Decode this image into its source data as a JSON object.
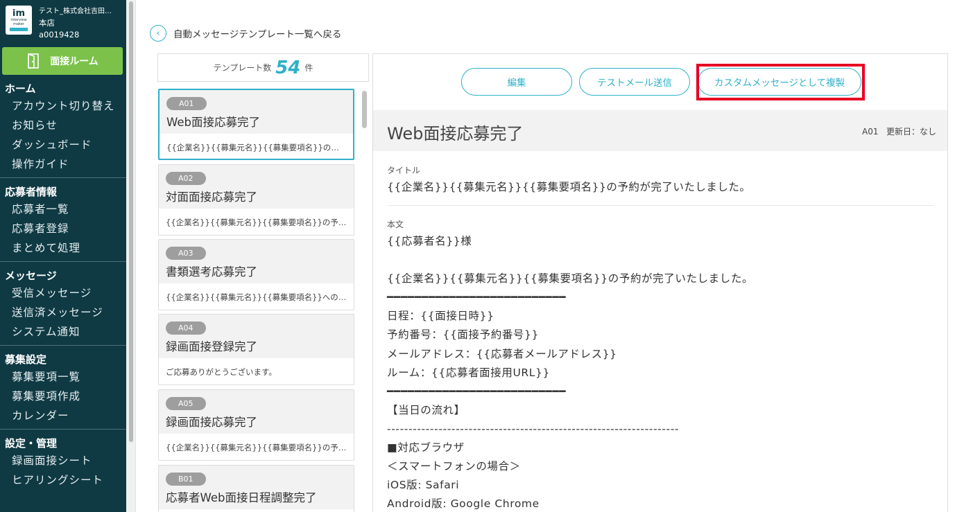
{
  "account": {
    "company": "テスト_株式会社吉田…",
    "branch": "本店",
    "id": "a0019428",
    "logo_main": "im",
    "logo_text1": "interview",
    "logo_text2": "maker"
  },
  "room_button": {
    "label": "面接ルーム",
    "icon": "door-icon"
  },
  "nav": [
    {
      "title": "ホーム",
      "items": [
        "アカウント切り替え",
        "お知らせ",
        "ダッシュボード",
        "操作ガイド"
      ]
    },
    {
      "title": "応募者情報",
      "items": [
        "応募者一覧",
        "応募者登録",
        "まとめて処理"
      ]
    },
    {
      "title": "メッセージ",
      "items": [
        "受信メッセージ",
        "送信済メッセージ",
        "システム通知"
      ]
    },
    {
      "title": "募集設定",
      "items": [
        "募集要項一覧",
        "募集要項作成",
        "カレンダー"
      ]
    },
    {
      "title": "設定・管理",
      "items": [
        "録画面接シート",
        "ヒアリングシート"
      ]
    }
  ],
  "back_link": {
    "label": "自動メッセージテンプレート一覧へ戻る"
  },
  "template_count": {
    "prefix": "テンプレート数",
    "count": "54",
    "suffix": "件"
  },
  "templates": [
    {
      "code": "A01",
      "name": "Web面接応募完了",
      "preview": "{{企業名}}{{募集元名}}{{募集要項名}}の予約が完了いたしました。",
      "selected": true
    },
    {
      "code": "A02",
      "name": "対面面接応募完了",
      "preview": "{{企業名}}{{募集元名}}{{募集要項名}}の予約が完了いたしました。",
      "selected": false
    },
    {
      "code": "A03",
      "name": "書類選考応募完了",
      "preview": "{{企業名}}{{募集元名}}{{募集要項名}}へのご応募ありがとうございます。",
      "selected": false
    },
    {
      "code": "A04",
      "name": "録画面接登録完了",
      "preview": "ご応募ありがとうございます。",
      "selected": false
    },
    {
      "code": "A05",
      "name": "録画面接応募完了",
      "preview": "{{企業名}}{{募集元名}}{{募集要項名}}の予約が完了いたしました。",
      "selected": false
    },
    {
      "code": "B01",
      "name": "応募者Web面接日程調整完了",
      "preview": "",
      "selected": false
    }
  ],
  "buttons": {
    "edit": "編集",
    "test_mail": "テストメール送信",
    "duplicate": "カスタムメッセージとして複製"
  },
  "detail": {
    "title": "Web面接応募完了",
    "code": "A01",
    "updated_label": "更新日：なし",
    "subject_label": "タイトル",
    "subject": "{{企業名}}{{募集元名}}{{募集要項名}}の予約が完了いたしました。",
    "body_label": "本文",
    "body_lines": [
      "{{応募者名}}様",
      "",
      "{{企業名}}{{募集元名}}{{募集要項名}}の予約が完了いたしました。",
      "━━━━━━━━━━━━━━━━━━━━━━━━━━",
      "日程：{{面接日時}}",
      "予約番号：{{面接予約番号}}",
      "メールアドレス：{{応募者メールアドレス}}",
      "ルーム：{{応募者面接用URL}}",
      "━━━━━━━━━━━━━━━━━━━━━━━━━━",
      "【当日の流れ】",
      "--------------------------------------------------------------------",
      "■対応ブラウザ",
      "＜スマートフォンの場合＞",
      "iOS版: Safari",
      "Android版: Google Chrome"
    ]
  },
  "colors": {
    "sidebar": "#0f3a44",
    "accent": "#2eb0c9",
    "room_button": "#7cc24a",
    "highlight": "#e60023"
  }
}
